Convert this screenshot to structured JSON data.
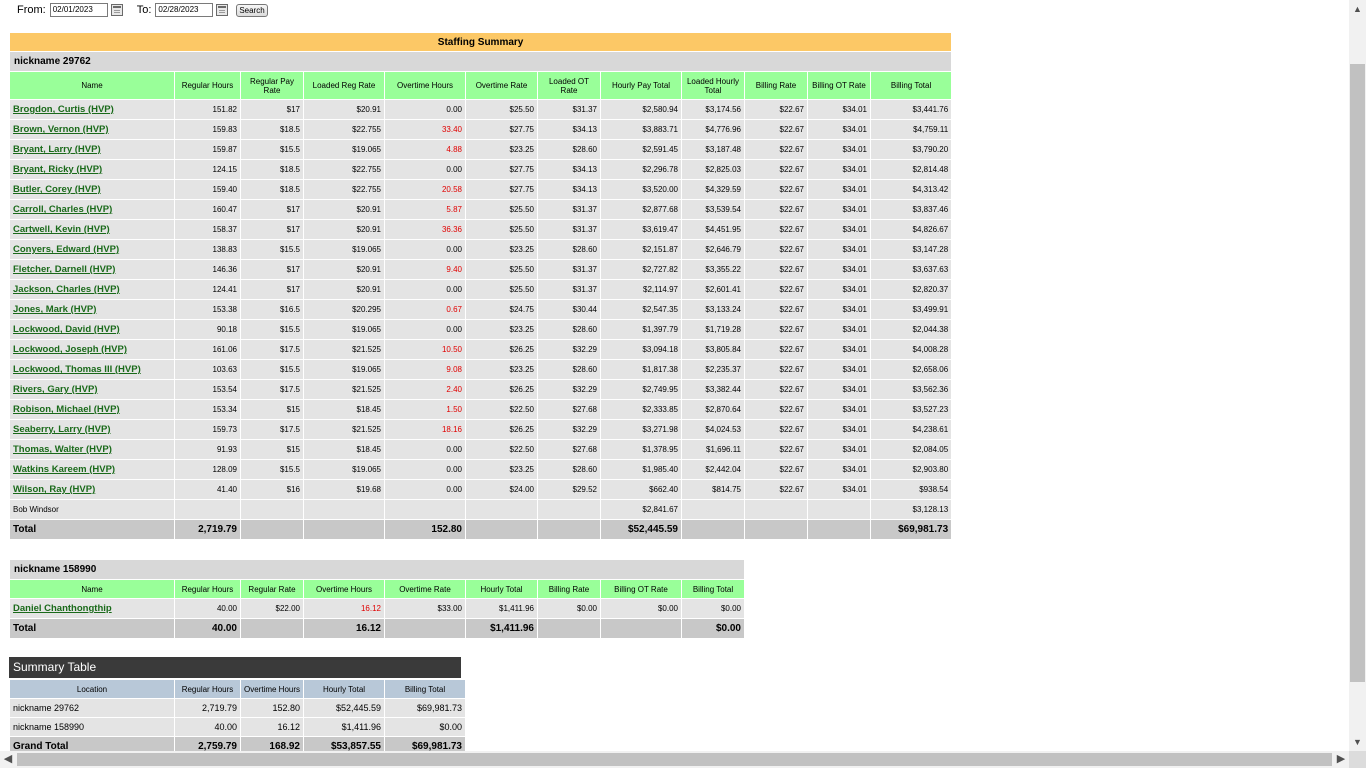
{
  "filter": {
    "from_label": "From:",
    "from_value": "02/01/2023",
    "to_label": "To:",
    "to_value": "02/28/2023",
    "search_label": "Search"
  },
  "staffing": {
    "title": "Staffing Summary",
    "group": "nickname 29762",
    "headers": [
      "Name",
      "Regular Hours",
      "Regular Pay Rate",
      "Loaded Reg Rate",
      "Overtime Hours",
      "Overtime Rate",
      "Loaded OT Rate",
      "Hourly Pay Total",
      "Loaded Hourly Total",
      "Billing Rate",
      "Billing OT Rate",
      "Billing Total"
    ],
    "rows": [
      [
        "Brogdon, Curtis (HVP)",
        "151.82",
        "$17",
        "$20.91",
        "0.00",
        "$25.50",
        "$31.37",
        "$2,580.94",
        "$3,174.56",
        "$22.67",
        "$34.01",
        "$3,441.76"
      ],
      [
        "Brown, Vernon (HVP)",
        "159.83",
        "$18.5",
        "$22.755",
        "33.40",
        "$27.75",
        "$34.13",
        "$3,883.71",
        "$4,776.96",
        "$22.67",
        "$34.01",
        "$4,759.11"
      ],
      [
        "Bryant, Larry (HVP)",
        "159.87",
        "$15.5",
        "$19.065",
        "4.88",
        "$23.25",
        "$28.60",
        "$2,591.45",
        "$3,187.48",
        "$22.67",
        "$34.01",
        "$3,790.20"
      ],
      [
        "Bryant, Ricky (HVP)",
        "124.15",
        "$18.5",
        "$22.755",
        "0.00",
        "$27.75",
        "$34.13",
        "$2,296.78",
        "$2,825.03",
        "$22.67",
        "$34.01",
        "$2,814.48"
      ],
      [
        "Butler, Corey (HVP)",
        "159.40",
        "$18.5",
        "$22.755",
        "20.58",
        "$27.75",
        "$34.13",
        "$3,520.00",
        "$4,329.59",
        "$22.67",
        "$34.01",
        "$4,313.42"
      ],
      [
        "Carroll, Charles (HVP)",
        "160.47",
        "$17",
        "$20.91",
        "5.87",
        "$25.50",
        "$31.37",
        "$2,877.68",
        "$3,539.54",
        "$22.67",
        "$34.01",
        "$3,837.46"
      ],
      [
        "Cartwell, Kevin (HVP)",
        "158.37",
        "$17",
        "$20.91",
        "36.36",
        "$25.50",
        "$31.37",
        "$3,619.47",
        "$4,451.95",
        "$22.67",
        "$34.01",
        "$4,826.67"
      ],
      [
        "Conyers, Edward (HVP)",
        "138.83",
        "$15.5",
        "$19.065",
        "0.00",
        "$23.25",
        "$28.60",
        "$2,151.87",
        "$2,646.79",
        "$22.67",
        "$34.01",
        "$3,147.28"
      ],
      [
        "Fletcher, Darnell (HVP)",
        "146.36",
        "$17",
        "$20.91",
        "9.40",
        "$25.50",
        "$31.37",
        "$2,727.82",
        "$3,355.22",
        "$22.67",
        "$34.01",
        "$3,637.63"
      ],
      [
        "Jackson, Charles (HVP)",
        "124.41",
        "$17",
        "$20.91",
        "0.00",
        "$25.50",
        "$31.37",
        "$2,114.97",
        "$2,601.41",
        "$22.67",
        "$34.01",
        "$2,820.37"
      ],
      [
        "Jones, Mark (HVP)",
        "153.38",
        "$16.5",
        "$20.295",
        "0.67",
        "$24.75",
        "$30.44",
        "$2,547.35",
        "$3,133.24",
        "$22.67",
        "$34.01",
        "$3,499.91"
      ],
      [
        "Lockwood, David (HVP)",
        "90.18",
        "$15.5",
        "$19.065",
        "0.00",
        "$23.25",
        "$28.60",
        "$1,397.79",
        "$1,719.28",
        "$22.67",
        "$34.01",
        "$2,044.38"
      ],
      [
        "Lockwood, Joseph (HVP)",
        "161.06",
        "$17.5",
        "$21.525",
        "10.50",
        "$26.25",
        "$32.29",
        "$3,094.18",
        "$3,805.84",
        "$22.67",
        "$34.01",
        "$4,008.28"
      ],
      [
        "Lockwood, Thomas III (HVP)",
        "103.63",
        "$15.5",
        "$19.065",
        "9.08",
        "$23.25",
        "$28.60",
        "$1,817.38",
        "$2,235.37",
        "$22.67",
        "$34.01",
        "$2,658.06"
      ],
      [
        "Rivers, Gary (HVP)",
        "153.54",
        "$17.5",
        "$21.525",
        "2.40",
        "$26.25",
        "$32.29",
        "$2,749.95",
        "$3,382.44",
        "$22.67",
        "$34.01",
        "$3,562.36"
      ],
      [
        "Robison, Michael (HVP)",
        "153.34",
        "$15",
        "$18.45",
        "1.50",
        "$22.50",
        "$27.68",
        "$2,333.85",
        "$2,870.64",
        "$22.67",
        "$34.01",
        "$3,527.23"
      ],
      [
        "Seaberry, Larry (HVP)",
        "159.73",
        "$17.5",
        "$21.525",
        "18.16",
        "$26.25",
        "$32.29",
        "$3,271.98",
        "$4,024.53",
        "$22.67",
        "$34.01",
        "$4,238.61"
      ],
      [
        "Thomas, Walter (HVP)",
        "91.93",
        "$15",
        "$18.45",
        "0.00",
        "$22.50",
        "$27.68",
        "$1,378.95",
        "$1,696.11",
        "$22.67",
        "$34.01",
        "$2,084.05"
      ],
      [
        "Watkins Kareem (HVP)",
        "128.09",
        "$15.5",
        "$19.065",
        "0.00",
        "$23.25",
        "$28.60",
        "$1,985.40",
        "$2,442.04",
        "$22.67",
        "$34.01",
        "$2,903.80"
      ],
      [
        "Wilson, Ray (HVP)",
        "41.40",
        "$16",
        "$19.68",
        "0.00",
        "$24.00",
        "$29.52",
        "$662.40",
        "$814.75",
        "$22.67",
        "$34.01",
        "$938.54"
      ]
    ],
    "extra_row": {
      "name": "Bob Windsor",
      "hourly_pay_total": "$2,841.67",
      "billing_total": "$3,128.13"
    },
    "total": {
      "label": "Total",
      "regular_hours": "2,719.79",
      "overtime_hours": "152.80",
      "hourly_pay_total": "$52,445.59",
      "billing_total": "$69,981.73"
    }
  },
  "nick2": {
    "group": "nickname 158990",
    "headers": [
      "Name",
      "Regular Hours",
      "Regular Rate",
      "Overtime Hours",
      "Overtime Rate",
      "Hourly Total",
      "Billing Rate",
      "Billing OT Rate",
      "Billing Total"
    ],
    "rows": [
      [
        "Daniel Chanthongthip",
        "40.00",
        "$22.00",
        "16.12",
        "$33.00",
        "$1,411.96",
        "$0.00",
        "$0.00",
        "$0.00"
      ]
    ],
    "total": {
      "label": "Total",
      "regular_hours": "40.00",
      "overtime_hours": "16.12",
      "hourly_total": "$1,411.96",
      "billing_total": "$0.00"
    }
  },
  "summary": {
    "title": "Summary Table",
    "headers": [
      "Location",
      "Regular Hours",
      "Overtime Hours",
      "Hourly Total",
      "Billing Total"
    ],
    "rows": [
      [
        "nickname 29762",
        "2,719.79",
        "152.80",
        "$52,445.59",
        "$69,981.73"
      ],
      [
        "nickname 158990",
        "40.00",
        "16.12",
        "$1,411.96",
        "$0.00"
      ]
    ],
    "grand": [
      "Grand Total",
      "2,759.79",
      "168.92",
      "$53,857.55",
      "$69,981.73"
    ]
  },
  "scrollbars": {
    "up": "▲",
    "down": "▼",
    "left": "◀",
    "right": "▶"
  }
}
